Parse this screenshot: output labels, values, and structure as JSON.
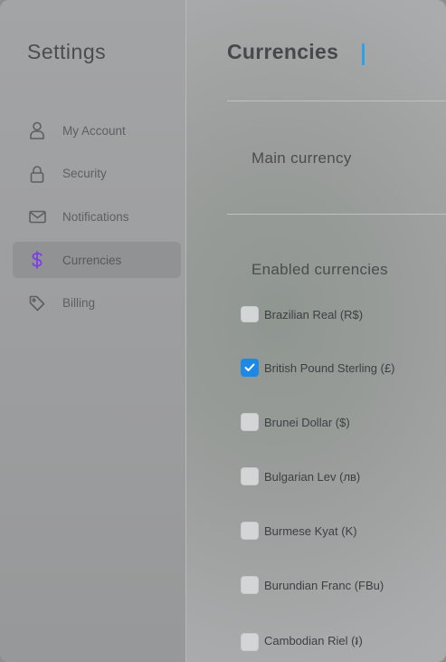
{
  "sidebar": {
    "title": "Settings",
    "items": [
      {
        "label": "My Account",
        "icon": "user-icon"
      },
      {
        "label": "Security",
        "icon": "lock-icon"
      },
      {
        "label": "Notifications",
        "icon": "mail-icon"
      },
      {
        "label": "Currencies",
        "icon": "dollar-icon",
        "active": true
      },
      {
        "label": "Billing",
        "icon": "tag-icon"
      }
    ]
  },
  "main": {
    "title": "Currencies",
    "main_currency_label": "Main currency",
    "enabled_currencies_label": "Enabled currencies",
    "currencies": [
      {
        "label": "Brazilian Real (R$)",
        "checked": false
      },
      {
        "label": "British Pound Sterling (£)",
        "checked": true
      },
      {
        "label": "Brunei Dollar ($)",
        "checked": false
      },
      {
        "label": "Bulgarian Lev (лв)",
        "checked": false
      },
      {
        "label": "Burmese Kyat (K)",
        "checked": false
      },
      {
        "label": "Burundian Franc (FBu)",
        "checked": false
      },
      {
        "label": "Cambodian Riel (៛)",
        "checked": false
      }
    ]
  },
  "colors": {
    "accent": "#1e88e5",
    "active_icon": "#7b3fe4",
    "cursor": "#2f9fe8"
  }
}
